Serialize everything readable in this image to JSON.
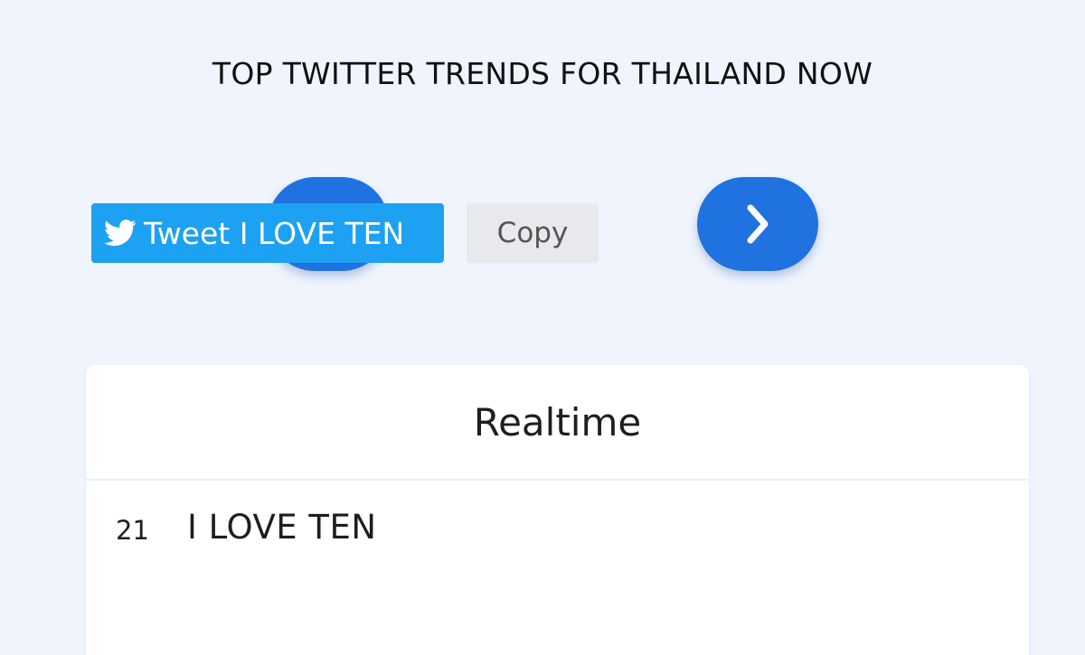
{
  "page": {
    "title": "TOP TWITTER TRENDS FOR THAILAND NOW"
  },
  "navigation": {
    "prev_icon": "chevron-left-icon",
    "next_icon": "chevron-right-icon",
    "accent_color": "#1f72e0"
  },
  "card": {
    "header": "Realtime",
    "trends": [
      {
        "rank": "21",
        "name": "I LOVE TEN",
        "tweet_label": "Tweet I LOVE TEN",
        "tweet_icon": "twitter-bird-icon",
        "copy_label": "Copy"
      }
    ]
  },
  "colors": {
    "background": "#eff4fd",
    "tweet_button": "#1da1f2",
    "copy_button": "#e8e9ec"
  }
}
